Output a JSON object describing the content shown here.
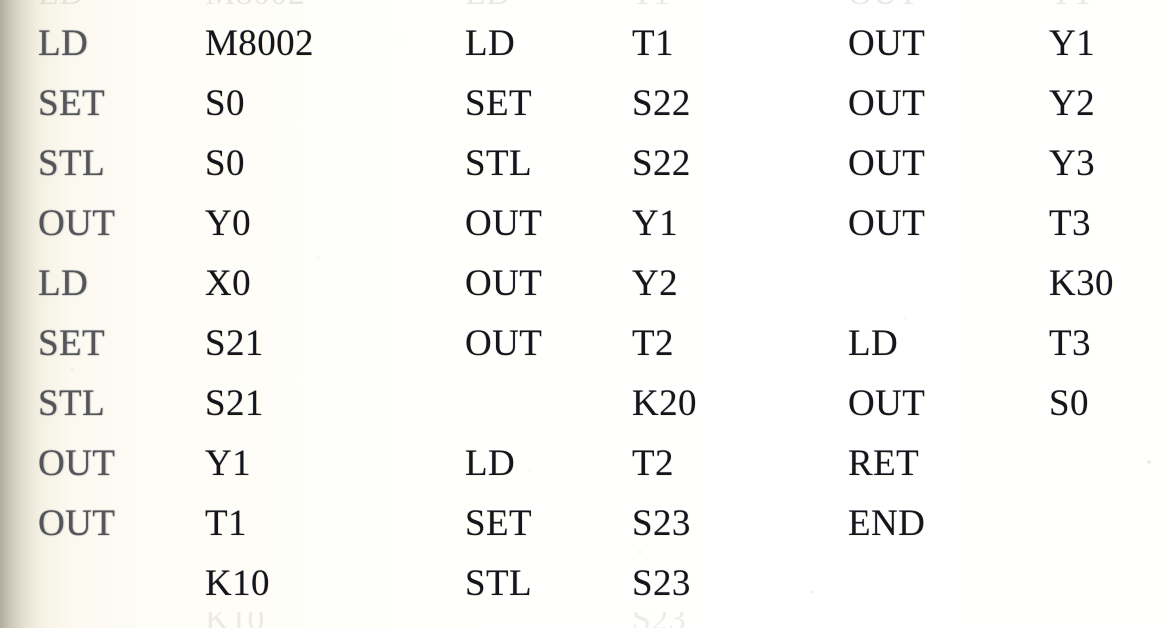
{
  "document": {
    "kind": "scanned-page",
    "content_type": "plc-instruction-list",
    "page_background": "#fdfcf6",
    "ink_color": "#16161a",
    "gutter_shadow_color": "#5a5646"
  },
  "program": {
    "columns": [
      {
        "id": "column-1",
        "rows": [
          {
            "instruction": "LD",
            "operand": "M8002"
          },
          {
            "instruction": "SET",
            "operand": "S0"
          },
          {
            "instruction": "STL",
            "operand": "S0"
          },
          {
            "instruction": "OUT",
            "operand": "Y0"
          },
          {
            "instruction": "LD",
            "operand": "X0"
          },
          {
            "instruction": "SET",
            "operand": "S21"
          },
          {
            "instruction": "STL",
            "operand": "S21"
          },
          {
            "instruction": "OUT",
            "operand": "Y1"
          },
          {
            "instruction": "OUT",
            "operand": "T1"
          },
          {
            "instruction": "",
            "operand": "K10"
          }
        ]
      },
      {
        "id": "column-2",
        "rows": [
          {
            "instruction": "LD",
            "operand": "T1"
          },
          {
            "instruction": "SET",
            "operand": "S22"
          },
          {
            "instruction": "STL",
            "operand": "S22"
          },
          {
            "instruction": "OUT",
            "operand": "Y1"
          },
          {
            "instruction": "OUT",
            "operand": "Y2"
          },
          {
            "instruction": "OUT",
            "operand": "T2"
          },
          {
            "instruction": "",
            "operand": "K20"
          },
          {
            "instruction": "LD",
            "operand": "T2"
          },
          {
            "instruction": "SET",
            "operand": "S23"
          },
          {
            "instruction": "STL",
            "operand": "S23"
          }
        ]
      },
      {
        "id": "column-3",
        "rows": [
          {
            "instruction": "OUT",
            "operand": "Y1"
          },
          {
            "instruction": "OUT",
            "operand": "Y2"
          },
          {
            "instruction": "OUT",
            "operand": "Y3"
          },
          {
            "instruction": "OUT",
            "operand": "T3"
          },
          {
            "instruction": "",
            "operand": "K30"
          },
          {
            "instruction": "LD",
            "operand": "T3"
          },
          {
            "instruction": "OUT",
            "operand": "S0"
          },
          {
            "instruction": "RET",
            "operand": ""
          },
          {
            "instruction": "END",
            "operand": ""
          },
          {
            "instruction": "",
            "operand": ""
          }
        ]
      }
    ]
  },
  "edges": {
    "top_clipped_hint": "S23",
    "bottom_clipped_hint": "K10"
  }
}
